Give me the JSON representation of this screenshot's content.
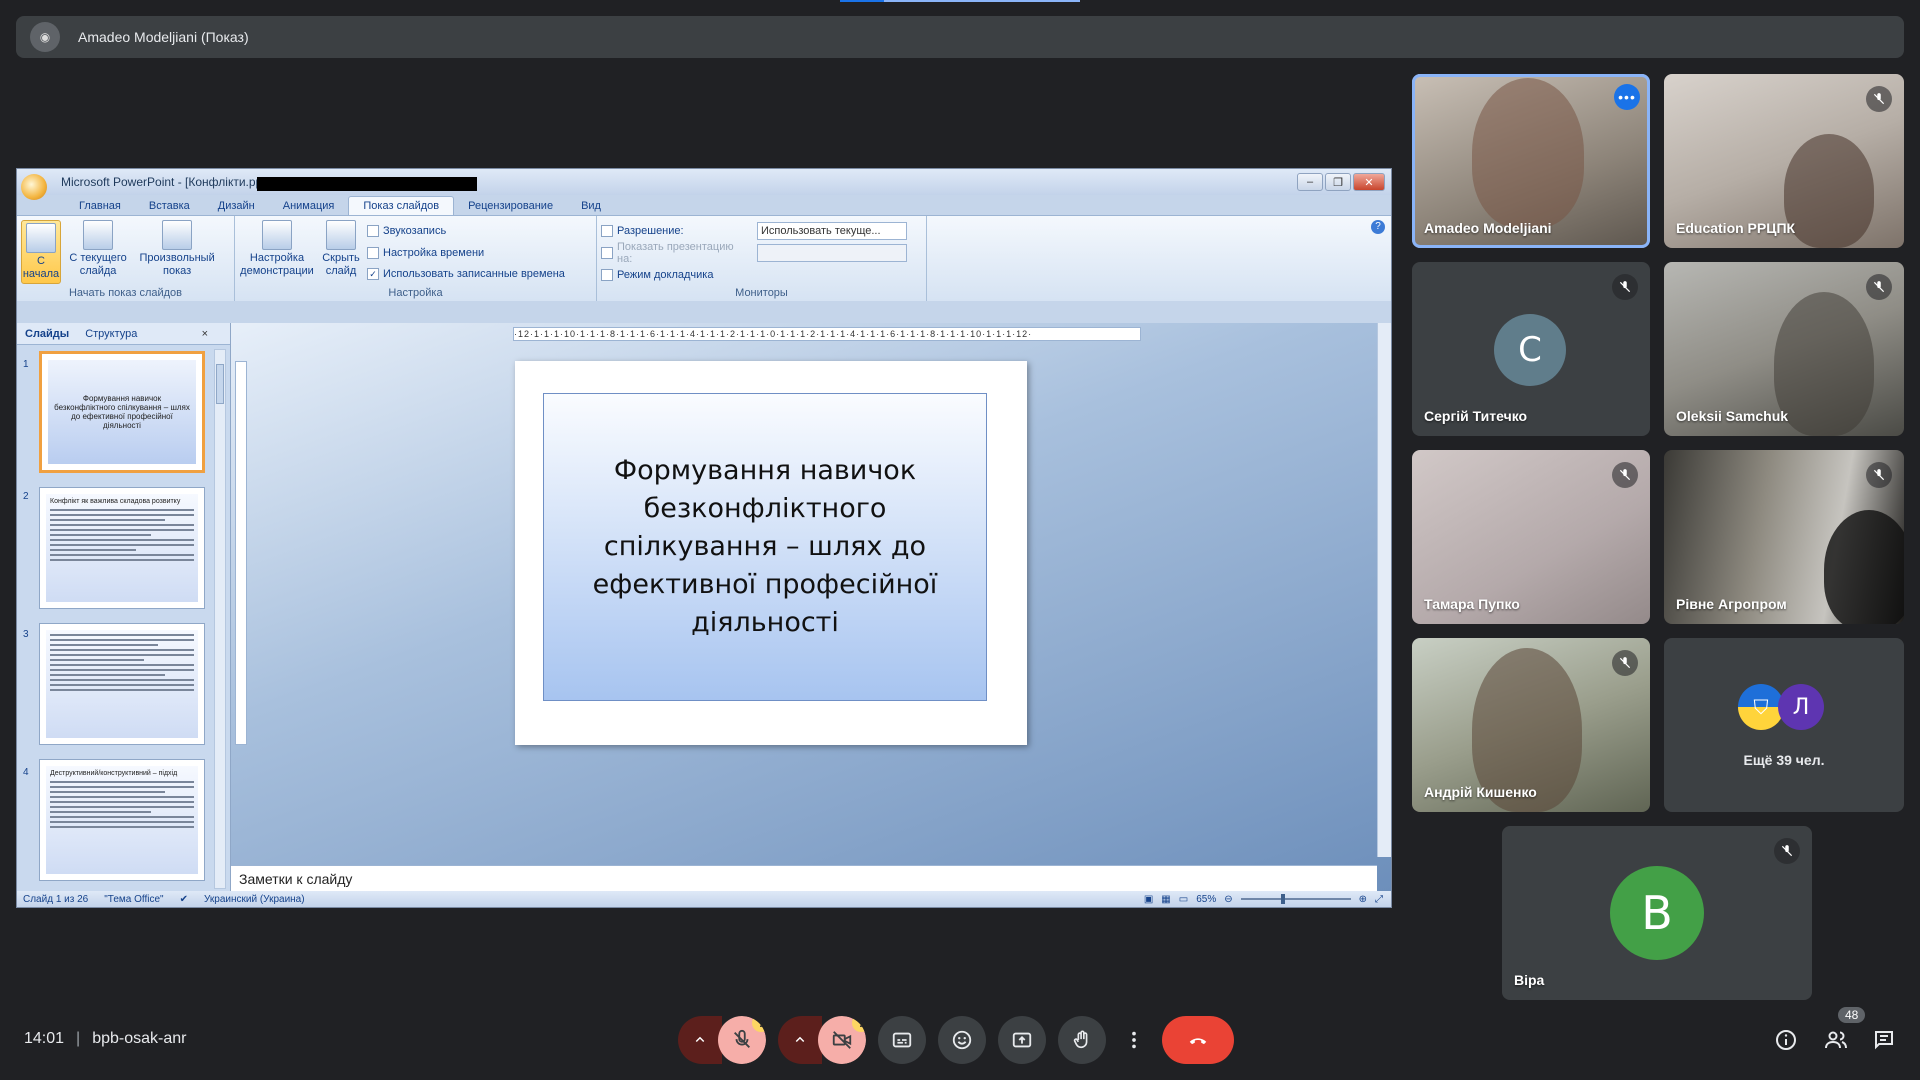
{
  "presenter": {
    "name": "Amadeo Modeljiani (Показ)"
  },
  "ppt": {
    "title": "Microsoft PowerPoint - [Конфлікти.ppt [Режим совместимости]]",
    "tabs": [
      "Главная",
      "Вставка",
      "Дизайн",
      "Анимация",
      "Показ слайдов",
      "Рецензирование",
      "Вид"
    ],
    "active_tab": "Показ слайдов",
    "groups": {
      "start": {
        "title": "Начать показ слайдов",
        "from_start": "С начала",
        "from_current": "С текущего слайда",
        "custom": "Произвольный показ"
      },
      "setup": {
        "title": "Настройка",
        "setup_show": "Настройка демонстрации",
        "hide_slide": "Скрыть слайд",
        "record": "Звукозапись",
        "timing": "Настройка времени",
        "use_timings": "Использовать записанные времена"
      },
      "monitors": {
        "title": "Мониторы",
        "resolution_label": "Разрешение:",
        "resolution_value": "Использовать текуще...",
        "show_on_label": "Показать презентацию на:",
        "presenter_view": "Режим докладчика"
      }
    },
    "pane_tabs": {
      "slides": "Слайды",
      "outline": "Структура"
    },
    "thumbnails": [
      {
        "num": "1",
        "text": "Формування навичок безконфліктного спілкування – шлях до ефективної професійної діяльності"
      },
      {
        "num": "2",
        "text": "Конфлікт як важлива складова розвитку"
      },
      {
        "num": "3",
        "text": ""
      },
      {
        "num": "4",
        "text": "Деструктивний/конструктивний – підхід"
      }
    ],
    "ruler": "·12·1·1·1·10·1·1·1·8·1·1·1·6·1·1·1·4·1·1·1·2·1·1·1·0·1·1·1·2·1·1·1·4·1·1·1·6·1·1·1·8·1·1·1·10·1·1·1·12·",
    "slide_text": "Формування навичок безконфліктного спілкування – шлях до ефективної професійної діяльності",
    "notes_placeholder": "Заметки к слайду",
    "status": {
      "slide": "Слайд 1 из 26",
      "theme": "\"Тема Office\"",
      "language": "Украинский (Украина)",
      "zoom": "65%"
    }
  },
  "participants": [
    {
      "name": "Amadeo Modeljiani"
    },
    {
      "name": "Education РРЦПК"
    },
    {
      "name": "Сергій Титечко",
      "initial": "C",
      "color": "#607d8b"
    },
    {
      "name": "Oleksii Samchuk"
    },
    {
      "name": "Тамара Пупко"
    },
    {
      "name": "Рівне Агропром"
    },
    {
      "name": "Андрій Кишенко"
    },
    {
      "name": "Віра",
      "initial": "B",
      "color": "#43a047"
    }
  ],
  "others": {
    "avatar_initial": "Л",
    "avatar_color": "#5e35b1",
    "label": "Ещё 39 чел."
  },
  "meeting": {
    "time": "14:01",
    "code": "bpb-osak-anr"
  },
  "people_count": "48",
  "colors": {
    "accent": "#8ab4f8",
    "end_call": "#ea4335",
    "muted": "#f6aea9"
  }
}
